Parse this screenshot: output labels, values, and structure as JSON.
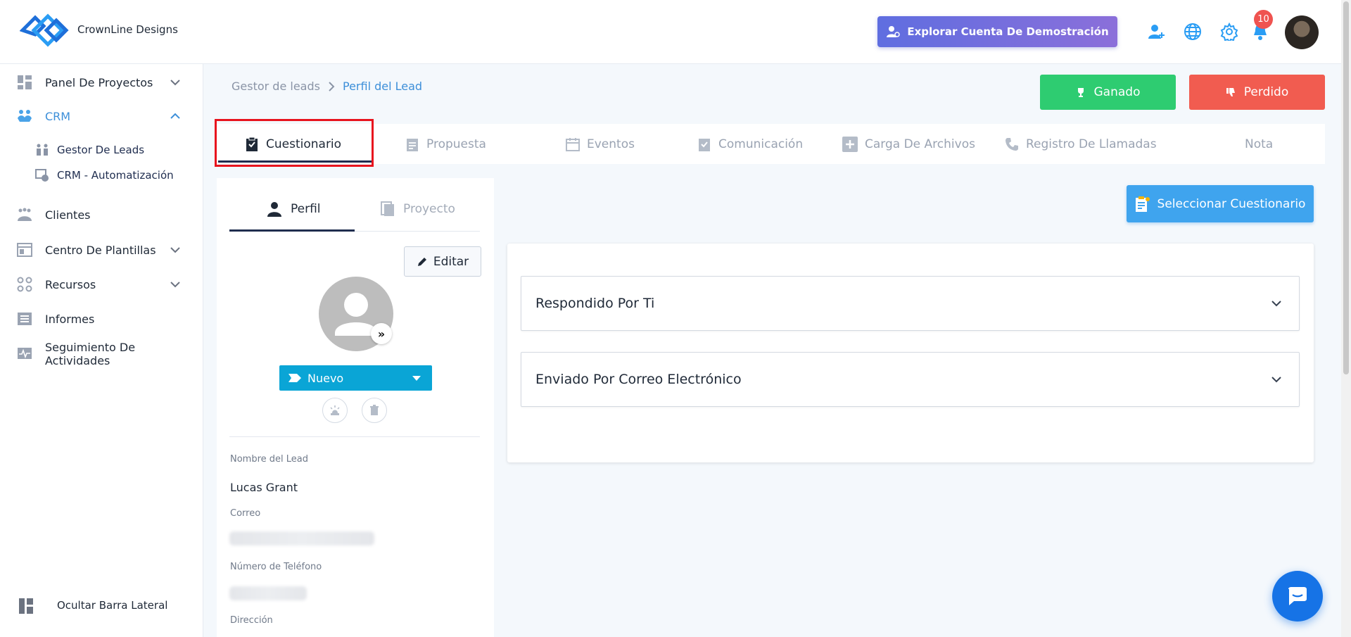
{
  "brand": {
    "name": "CrownLine Designs"
  },
  "header": {
    "demo_button": "Explorar Cuenta De Demostración",
    "notification_count": "10"
  },
  "sidebar": {
    "items": [
      {
        "label": "Panel De Proyectos",
        "icon": "dashboard-icon",
        "expandable": true
      },
      {
        "label": "CRM",
        "icon": "crm-icon",
        "expandable": true,
        "active": true
      },
      {
        "label": "Clientes",
        "icon": "clients-icon"
      },
      {
        "label": "Centro De Plantillas",
        "icon": "templates-icon",
        "expandable": true
      },
      {
        "label": "Recursos",
        "icon": "resources-icon",
        "expandable": true
      },
      {
        "label": "Informes",
        "icon": "reports-icon"
      },
      {
        "label": "Seguimiento De Actividades",
        "icon": "activity-icon"
      }
    ],
    "crm_sub": [
      {
        "label": "Gestor De Leads",
        "icon": "leads-icon"
      },
      {
        "label": "CRM - Automatización",
        "icon": "automation-icon"
      }
    ],
    "hide_label": "Ocultar Barra Lateral"
  },
  "breadcrumb": {
    "root": "Gestor de leads",
    "current": "Perfil del Lead"
  },
  "actions": {
    "won": "Ganado",
    "lost": "Perdido"
  },
  "tabs": [
    {
      "label": "Cuestionario",
      "active": true
    },
    {
      "label": "Propuesta"
    },
    {
      "label": "Eventos"
    },
    {
      "label": "Comunicación"
    },
    {
      "label": "Carga De Archivos"
    },
    {
      "label": "Registro De Llamadas"
    },
    {
      "label": "Nota"
    }
  ],
  "profile": {
    "tabs": {
      "profile": "Perfil",
      "project": "Proyecto"
    },
    "edit_button": "Editar",
    "status": "Nuevo",
    "fields": {
      "name_label": "Nombre del Lead",
      "name_value": "Lucas Grant",
      "email_label": "Correo",
      "phone_label": "Número de Teléfono",
      "address_label": "Dirección"
    }
  },
  "questionnaire": {
    "select_button": "Seleccionar Cuestionario",
    "sections": [
      {
        "title": "Respondido Por Ti"
      },
      {
        "title": "Enviado Por Correo Electrónico"
      }
    ]
  },
  "colors": {
    "won": "#2ecc71",
    "lost": "#f15c50",
    "accent": "#3fa4ee",
    "status": "#0aa5d6",
    "highlight": "#e8141e"
  }
}
